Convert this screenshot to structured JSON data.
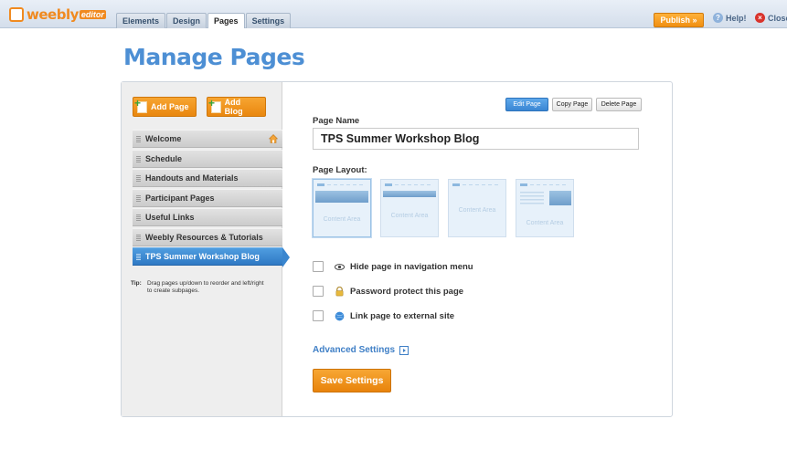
{
  "topbar": {
    "logo_text": "weebly",
    "logo_sub": "editor",
    "tabs": [
      "Elements",
      "Design",
      "Pages",
      "Settings"
    ],
    "active_tab": "Pages",
    "publish_label": "Publish »",
    "help_label": "Help!",
    "close_label": "Close"
  },
  "page_title": "Manage Pages",
  "sidebar": {
    "add_page_label": "Add Page",
    "add_blog_label": "Add Blog",
    "pages": [
      "Welcome",
      "Schedule",
      "Handouts and Materials",
      "Participant Pages",
      "Useful Links",
      "Weebly Resources & Tutorials",
      "TPS Summer Workshop Blog"
    ],
    "selected_page": "TPS Summer Workshop Blog",
    "tip_label": "Tip:",
    "tip_text": "Drag pages up/down to reorder and left/right to create subpages."
  },
  "editor": {
    "edit_page_label": "Edit Page",
    "copy_page_label": "Copy Page",
    "delete_page_label": "Delete Page",
    "page_name_label": "Page Name",
    "page_name_value": "TPS Summer Workshop Blog",
    "page_layout_label": "Page Layout:",
    "content_area_label": "Content Area",
    "options": {
      "hide_label": "Hide page in navigation menu",
      "password_label": "Password protect this page",
      "link_label": "Link page to external site"
    },
    "advanced_label": "Advanced Settings",
    "save_label": "Save Settings"
  },
  "colors": {
    "accent_orange": "#f08f12",
    "accent_blue": "#3a86d3",
    "title_blue": "#4d8fd4"
  }
}
